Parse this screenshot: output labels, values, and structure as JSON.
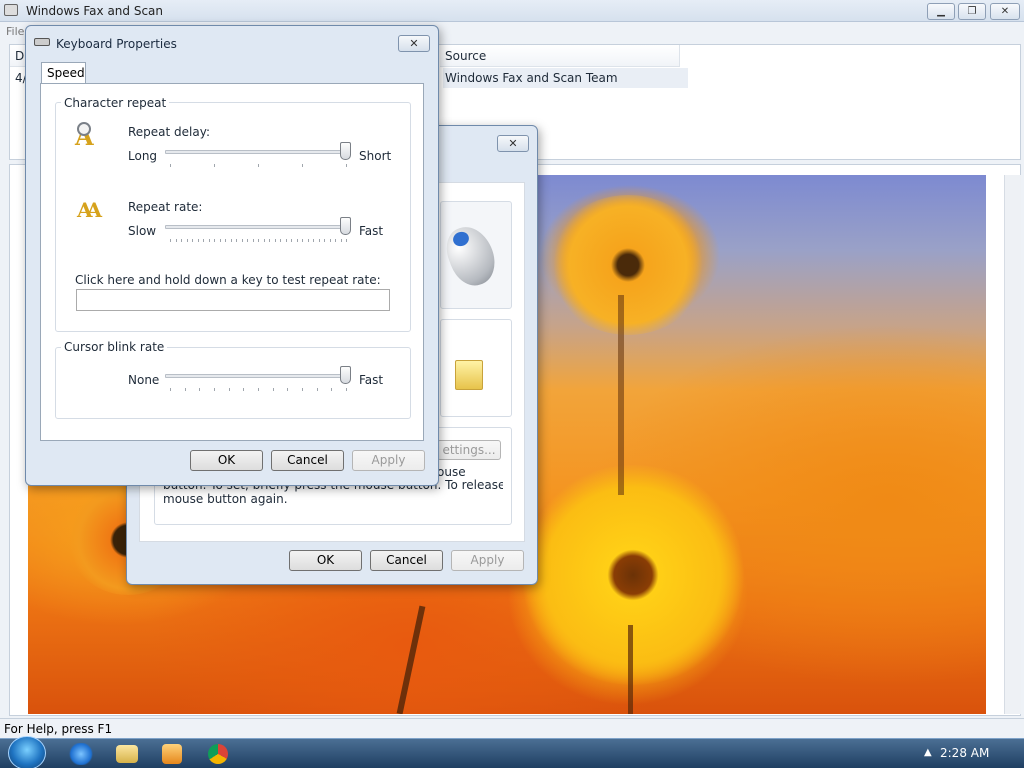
{
  "main_window": {
    "title": "Windows Fax and Scan",
    "menu_file": "File",
    "columns": {
      "date": "Da",
      "source": "Source"
    },
    "row": {
      "date": "4/",
      "source": "Windows Fax and Scan Team"
    },
    "status": "For Help, press F1",
    "buttons": {
      "minimize": "▁",
      "restore": "❐",
      "close": "✕"
    }
  },
  "mouse_dialog": {
    "close": "✕",
    "settings_button": "ettings...",
    "clicklock_text_1": "ouse",
    "clicklock_text_2": "button. To set, briefly press the mouse button. To release, click the",
    "clicklock_text_3": "mouse button again.",
    "ok": "OK",
    "cancel": "Cancel",
    "apply": "Apply"
  },
  "keyboard_dialog": {
    "title": "Keyboard Properties",
    "close": "✕",
    "tab_speed": "Speed",
    "character_repeat": {
      "group_label": "Character repeat",
      "repeat_delay_label": "Repeat delay:",
      "delay_min": "Long",
      "delay_max": "Short",
      "delay_value": 1.0,
      "repeat_rate_label": "Repeat rate:",
      "rate_min": "Slow",
      "rate_max": "Fast",
      "rate_value": 1.0,
      "test_label": "Click here and hold down a key to test repeat rate:",
      "test_value": ""
    },
    "cursor_blink": {
      "group_label": "Cursor blink rate",
      "min": "None",
      "max": "Fast",
      "value": 1.0
    },
    "ok": "OK",
    "cancel": "Cancel",
    "apply": "Apply"
  },
  "taskbar": {
    "clock": "2:28 AM",
    "tray_arrow": "▲",
    "icons": [
      "start-icon",
      "internet-explorer-icon",
      "windows-explorer-icon",
      "media-player-icon",
      "chrome-icon"
    ]
  }
}
